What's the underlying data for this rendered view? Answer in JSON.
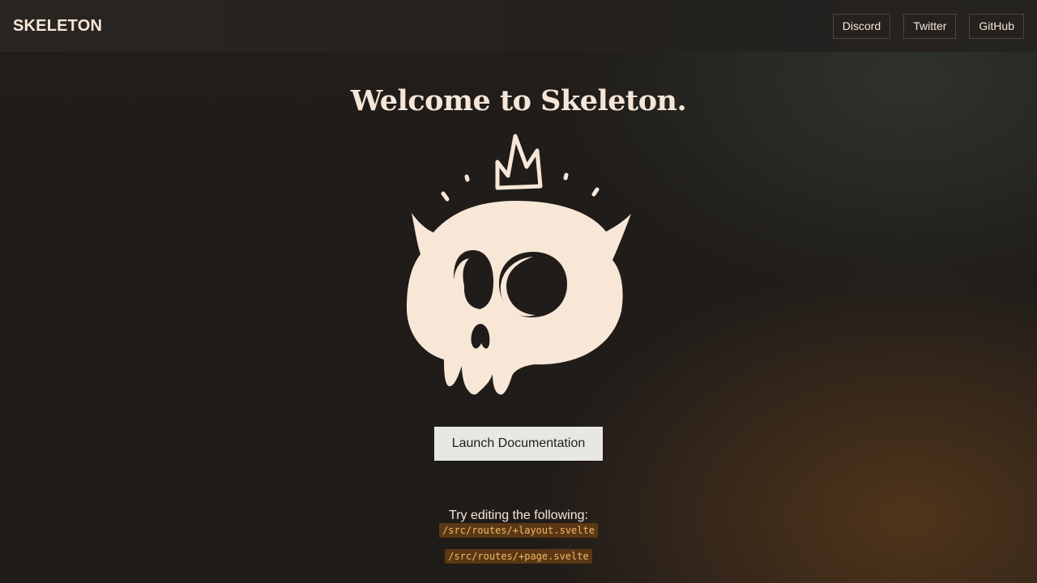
{
  "app_bar": {
    "brand": "SKELETON",
    "links": [
      {
        "label": "Discord"
      },
      {
        "label": "Twitter"
      },
      {
        "label": "GitHub"
      }
    ]
  },
  "hero": {
    "title": "Welcome to Skeleton.",
    "logo_icon": "skeleton-skull-crown-icon",
    "cta_label": "Launch Documentation",
    "hint": "Try editing the following:",
    "files": [
      "/src/routes/+layout.svelte",
      "/src/routes/+page.svelte"
    ]
  },
  "colors": {
    "background": "#1f1b19",
    "header_background": "#292522",
    "text": "#f6e6d7",
    "button": "#e7e7e4",
    "code_background": "#5b3814",
    "code_text": "#f2b868"
  }
}
